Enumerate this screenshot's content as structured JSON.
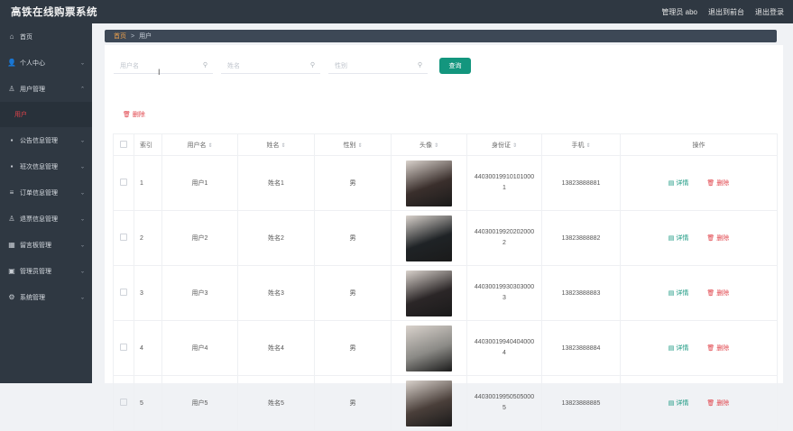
{
  "app": {
    "title": "高铁在线购票系统"
  },
  "topbar": {
    "admin": "管理员 abo",
    "front": "退出到前台",
    "logout": "退出登录"
  },
  "sidebar": {
    "items": [
      {
        "label": "首页",
        "icon": "home-icon",
        "glyph": "⌂",
        "chev": ""
      },
      {
        "label": "个人中心",
        "icon": "user-icon",
        "glyph": "👤",
        "chev": "⌄"
      },
      {
        "label": "用户管理",
        "icon": "user-manage-icon",
        "glyph": "♙",
        "chev": "⌃"
      },
      {
        "label": "公告信息管理",
        "icon": "notice-icon",
        "glyph": "▪",
        "chev": "⌄"
      },
      {
        "label": "班次信息管理",
        "icon": "train-icon",
        "glyph": "▪",
        "chev": "⌄"
      },
      {
        "label": "订单信息管理",
        "icon": "list-icon",
        "glyph": "≡",
        "chev": "⌄"
      },
      {
        "label": "退票信息管理",
        "icon": "refund-icon",
        "glyph": "♙",
        "chev": "⌄"
      },
      {
        "label": "留言板管理",
        "icon": "message-icon",
        "glyph": "▦",
        "chev": "⌄"
      },
      {
        "label": "管理员管理",
        "icon": "admin-icon",
        "glyph": "▣",
        "chev": "⌄"
      },
      {
        "label": "系统管理",
        "icon": "settings-icon",
        "glyph": "⚙",
        "chev": "⌄"
      }
    ],
    "sub_active": "用户"
  },
  "breadcrumb": {
    "home": "首页",
    "sep": ">",
    "current": "用户"
  },
  "search": {
    "username_placeholder": "用户名",
    "name_placeholder": "姓名",
    "gender_placeholder": "性别",
    "button": "查询"
  },
  "actions": {
    "delete": "🗑 删除"
  },
  "table": {
    "headers": {
      "index": "索引",
      "username": "用户名",
      "name": "姓名",
      "gender": "性别",
      "avatar": "头像",
      "idcard": "身份证",
      "phone": "手机",
      "ops": "操作"
    },
    "sort_glyph": "⇕",
    "detail_label": "▤ 详情",
    "delete_label": "🗑 删除",
    "rows": [
      {
        "index": "1",
        "username": "用户1",
        "name": "姓名1",
        "gender": "男",
        "idcard": "440300199101010001",
        "phone": "13823888881",
        "avatar_color": "#3a2f2c"
      },
      {
        "index": "2",
        "username": "用户2",
        "name": "姓名2",
        "gender": "男",
        "idcard": "440300199202020002",
        "phone": "13823888882",
        "avatar_color": "#1f2326"
      },
      {
        "index": "3",
        "username": "用户3",
        "name": "姓名3",
        "gender": "男",
        "idcard": "440300199303030003",
        "phone": "13823888883",
        "avatar_color": "#2b2627"
      },
      {
        "index": "4",
        "username": "用户4",
        "name": "姓名4",
        "gender": "男",
        "idcard": "440300199404040004",
        "phone": "13823888884",
        "avatar_color": "#8b8a86"
      },
      {
        "index": "5",
        "username": "用户5",
        "name": "姓名5",
        "gender": "男",
        "idcard": "440300199505050005",
        "phone": "13823888885",
        "avatar_color": "#4a3f3a"
      }
    ]
  },
  "colors": {
    "sidebar": "#2f3842",
    "accent": "#13967e",
    "danger": "#e0434a",
    "breadcrumb_home": "#f0a24b"
  }
}
